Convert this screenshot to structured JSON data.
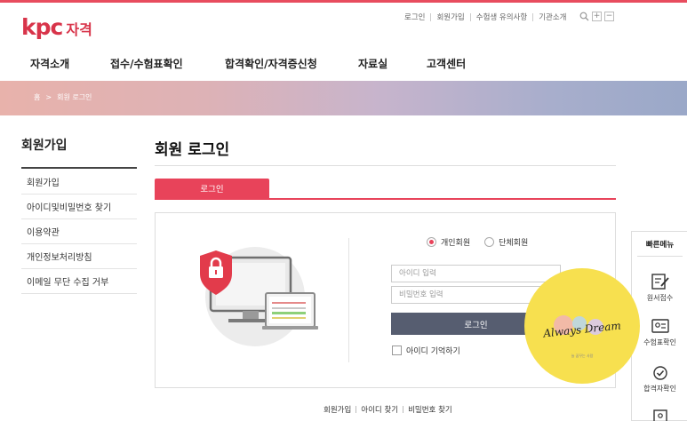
{
  "brand": {
    "logo_kpc": "kpc",
    "logo_sub": "자격",
    "accent": "#e8435a"
  },
  "util_nav": [
    "로그인",
    "회원가입",
    "수험생 유의사항",
    "기관소개"
  ],
  "util_icons": [
    "search-icon",
    "plus-icon",
    "minus-icon"
  ],
  "gnb": [
    "자격소개",
    "접수/수험표확인",
    "합격확인/자격증신청",
    "자료실",
    "고객센터"
  ],
  "breadcrumb": {
    "home": "홈",
    "separator": ">",
    "current": "회원 로그인"
  },
  "sidebar": {
    "title": "회원가입",
    "items": [
      "회원가입",
      "아이디및비밀번호 찾기",
      "이용약관",
      "개인정보처리방침",
      "이메일 무단 수집 거부"
    ]
  },
  "main": {
    "title": "회원 로그인",
    "tab": "로그인",
    "member_types": [
      {
        "label": "개인회원",
        "selected": true
      },
      {
        "label": "단체회원",
        "selected": false
      }
    ],
    "id_placeholder": "아이디 입력",
    "pw_placeholder": "비밀번호 입력",
    "login_button": "로그인",
    "remember_label": "아이디 기억하기",
    "remember_checked": false
  },
  "bottom_links": [
    "회원가입",
    "아이디 찾기",
    "비밀번호 찾기"
  ],
  "quick_menu": {
    "title": "빠른메뉴",
    "items": [
      {
        "label": "원서접수",
        "icon": "form-pen-icon"
      },
      {
        "label": "수험표확인",
        "icon": "id-card-icon"
      },
      {
        "label": "합격자확인",
        "icon": "certificate-icon"
      },
      {
        "label": "",
        "icon": "document-icon"
      }
    ]
  },
  "watermark": {
    "title": "Always Dream",
    "subtitle": "늘 꿈꾸는 사람"
  }
}
